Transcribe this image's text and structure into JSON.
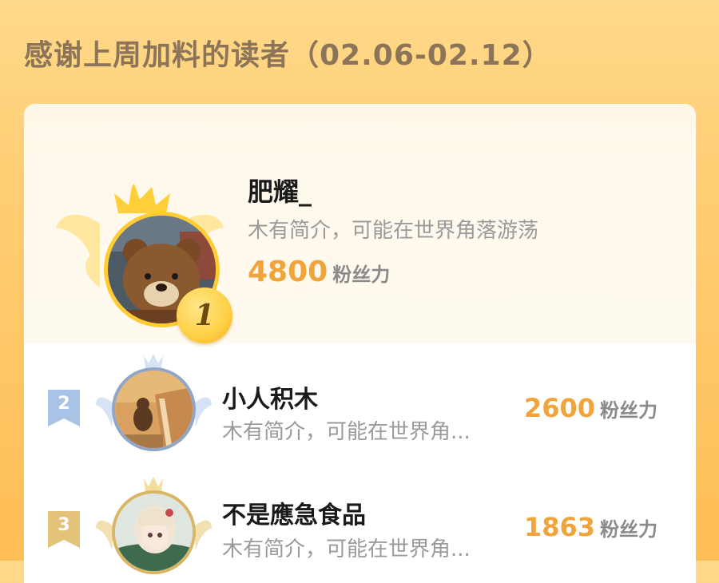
{
  "header": {
    "title": "感谢上周加料的读者（02.06-02.12）"
  },
  "score_unit": "粉丝力",
  "top_reader": {
    "rank": "1",
    "name": "肥耀_",
    "bio": "木有简介，可能在世界角落游荡",
    "score": "4800"
  },
  "readers": [
    {
      "rank": "2",
      "name": "小人积木",
      "bio": "木有简介，可能在世界角...",
      "score": "2600",
      "badge_color": "#a9c3e6"
    },
    {
      "rank": "3",
      "name": "不是應急食品",
      "bio": "木有简介，可能在世界角...",
      "score": "1863",
      "badge_color": "#e3c27a"
    }
  ],
  "colors": {
    "accent": "#f0a43a",
    "gold": "#ffcc33",
    "silver": "#a9c3e6",
    "bronze": "#e3c27a"
  }
}
